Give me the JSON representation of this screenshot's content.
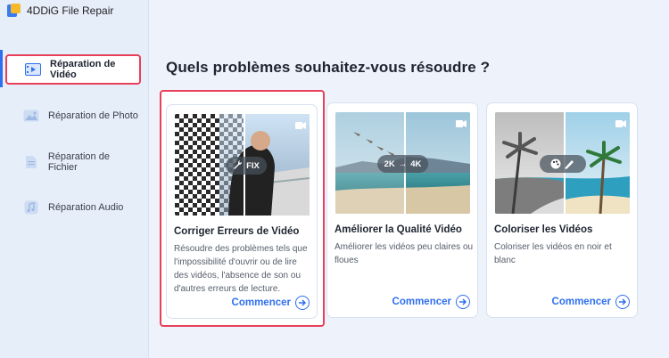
{
  "app": {
    "title": "4DDiG File Repair"
  },
  "sidebar": {
    "items": [
      {
        "label": "Réparation de Vidéo",
        "icon": "video-repair-icon",
        "active": true
      },
      {
        "label": "Réparation de Photo",
        "icon": "photo-repair-icon",
        "active": false
      },
      {
        "label": "Réparation de Fichier",
        "icon": "file-repair-icon",
        "active": false
      },
      {
        "label": "Réparation Audio",
        "icon": "audio-repair-icon",
        "active": false
      }
    ]
  },
  "main": {
    "heading": "Quels problèmes souhaitez-vous résoudre ?",
    "cards": [
      {
        "title": "Corriger Erreurs de Vidéo",
        "description": "Résoudre des problèmes tels que l'impossibilité d'ouvrir ou de lire des vidéos, l'absence de son ou d'autres erreurs de lecture.",
        "badge": "FIX",
        "cta": "Commencer",
        "selected": true
      },
      {
        "title": "Améliorer la Qualité Vidéo",
        "description": "Améliorer les vidéos peu claires ou floues",
        "badge_from": "2K",
        "badge_to": "4K",
        "cta": "Commencer",
        "selected": false
      },
      {
        "title": "Coloriser les Vidéos",
        "description": "Coloriser les vidéos en noir et blanc",
        "badge": "palette-brush-icon",
        "cta": "Commencer",
        "selected": false
      }
    ]
  },
  "colors": {
    "accent": "#2f6fed",
    "selection": "#e8405a",
    "background": "#eef3fb"
  }
}
